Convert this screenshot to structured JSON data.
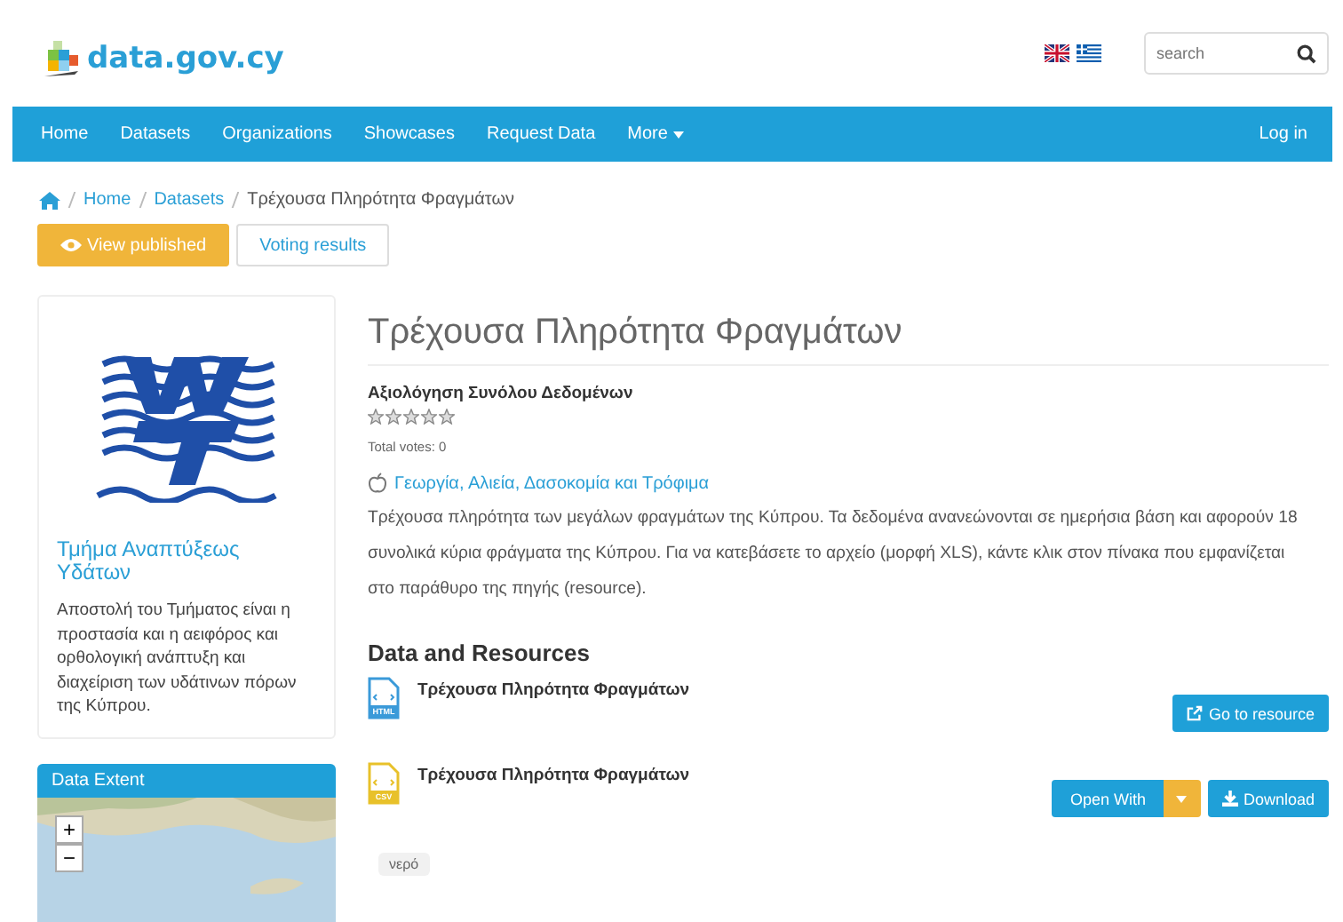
{
  "header": {
    "logo": "data.gov.cy",
    "search": {
      "placeholder": "search"
    }
  },
  "nav": {
    "items": [
      "Home",
      "Datasets",
      "Organizations",
      "Showcases",
      "Request Data",
      "More"
    ],
    "login": "Log in"
  },
  "breadcrumb": [
    "Home",
    "Datasets",
    "Τρέχουσα Πληρότητα Φραγμάτων"
  ],
  "actions": [
    {
      "label": "View published",
      "selected": true
    },
    {
      "label": "Voting results",
      "selected": false
    }
  ],
  "organization": {
    "name": "Τμήμα Αναπτύξεως Υδάτων",
    "description": "Αποστολή του Τμήματος είναι η προστασία και η αειφόρος και ορθολογική ανάπτυξη και διαχείριση των υδάτινων πόρων της Κύπρου."
  },
  "map_panel": {
    "title": "Data Extent",
    "zoom_in": "+",
    "zoom_out": "−"
  },
  "dataset": {
    "title": "Τρέχουσα Πληρότητα Φραγμάτων",
    "rating_label": "Αξιολόγηση Συνόλου Δεδομένων",
    "stars": 0,
    "votes": "Total votes: 0",
    "group": "Γεωργία, Αλιεία, Δασοκομία και Τρόφιμα",
    "description": "Τρέχουσα πληρότητα των μεγάλων φραγμάτων της Κύπρου. Τα δεδομένα ανανεώνονται σε ημερήσια βάση και αφορούν 18 συνολικά κύρια φράγματα της Κύπρου. Για να κατεβάσετε το αρχείο (μορφή XLS), κάντε κλικ στον πίνακα που εμφανίζεται στο παράθυρο της πηγής (resource)."
  },
  "resources": {
    "heading": "Data and Resources",
    "items": [
      {
        "name": "Τρέχουσα Πληρότητα Φραγμάτων",
        "format": "HTML",
        "kind": "link",
        "buttons": [
          "Go to resource"
        ]
      },
      {
        "name": "Τρέχουσα Πληρότητα Φραγμάτων",
        "format": "CSV",
        "kind": "file",
        "buttons": [
          "Open With",
          "Download"
        ]
      }
    ]
  },
  "tags": [
    "νερό"
  ]
}
